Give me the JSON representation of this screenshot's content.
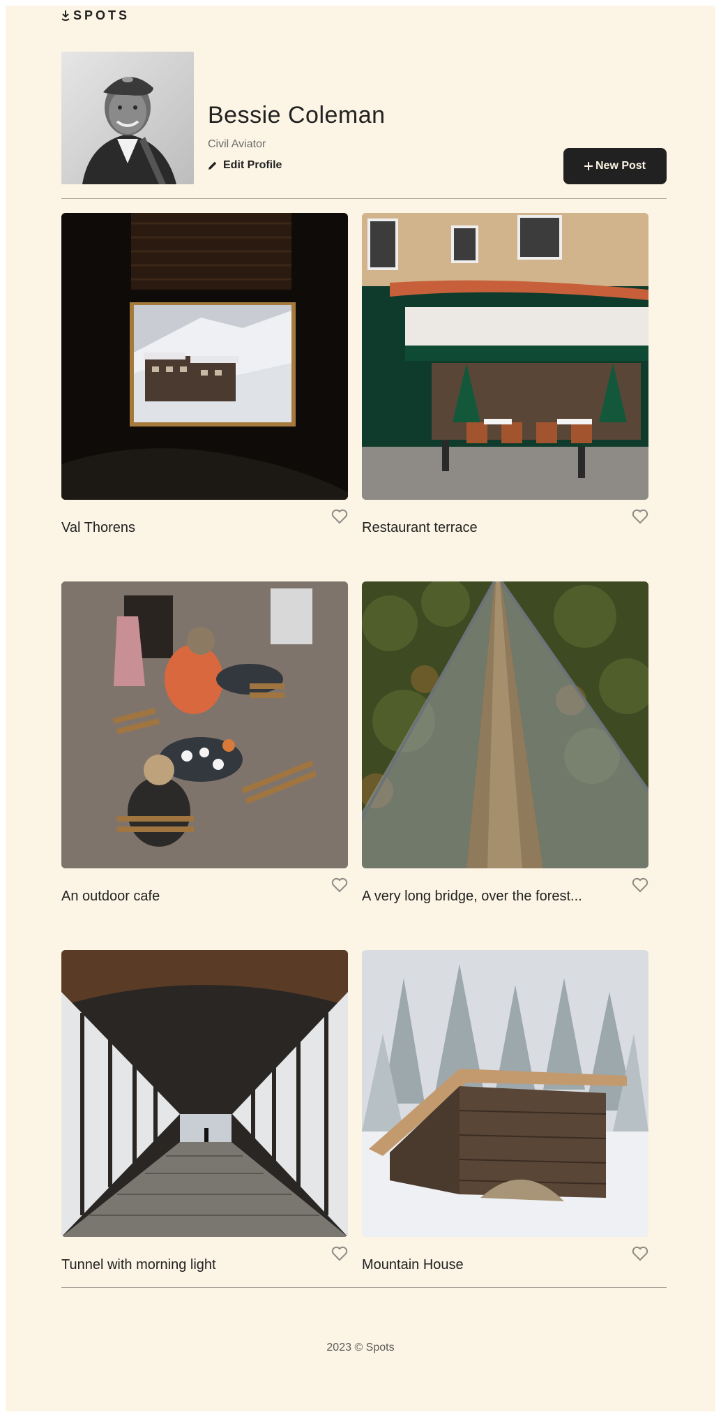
{
  "header": {
    "logo_text": "SPOTS",
    "logo_icon": "pin-drop-icon"
  },
  "profile": {
    "name": "Bessie Coleman",
    "description": "Civil Aviator",
    "edit_label": "Edit Profile",
    "new_post_label": "New Post"
  },
  "cards": [
    {
      "title": "Val Thorens",
      "liked": false
    },
    {
      "title": "Restaurant terrace",
      "liked": false
    },
    {
      "title": "An outdoor cafe",
      "liked": false
    },
    {
      "title": "A very long bridge, over the forest...",
      "liked": false
    },
    {
      "title": "Tunnel with morning light",
      "liked": false
    },
    {
      "title": "Mountain House",
      "liked": false
    }
  ],
  "footer": {
    "text": "2023 © Spots"
  },
  "colors": {
    "background": "#fcf5e5",
    "text": "#212121",
    "button": "#212121",
    "heart_outline": "#8e8a85"
  }
}
